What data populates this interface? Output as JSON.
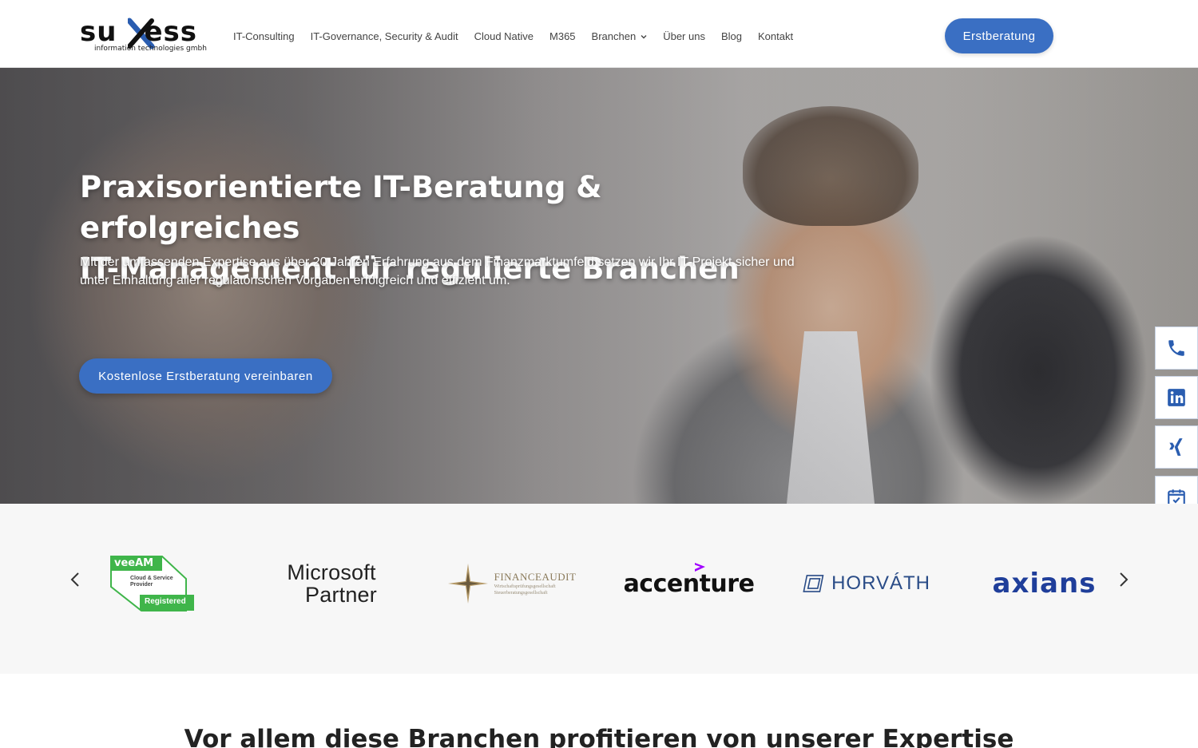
{
  "header": {
    "logo": {
      "name": "suxess",
      "sub": "information technologies gmbh"
    },
    "nav": [
      {
        "label": "IT-Consulting"
      },
      {
        "label": "IT-Governance, Security & Audit"
      },
      {
        "label": "Cloud Native"
      },
      {
        "label": "M365"
      },
      {
        "label": "Branchen",
        "has_dropdown": true
      },
      {
        "label": "Über uns"
      },
      {
        "label": "Blog"
      },
      {
        "label": "Kontakt"
      }
    ],
    "cta_label": "Erstberatung"
  },
  "hero": {
    "title_line1": "Praxisorientierte IT-Beratung & erfolgreiches",
    "title_line2": "IT-Management für regulierte Branchen",
    "subtitle": "Mit der umfassenden Expertise aus über 20 Jahren Erfahrung aus dem Finanzmarktumfeld setzen wir Ihr IT-Projekt sicher und unter Einhaltung aller regulatorischen Vorgaben erfolgreich und effizient um.",
    "cta_label": "Kostenlose Erstberatung vereinbaren"
  },
  "side_bar": {
    "items": [
      "phone-icon",
      "linkedin-icon",
      "xing-icon",
      "calendar-icon"
    ]
  },
  "partners": {
    "veeam": {
      "brand": "veeAM",
      "line1": "Cloud & Service",
      "line2": "Provider",
      "badge": "Registered"
    },
    "microsoft": {
      "line1": "Microsoft",
      "line2": "Partner"
    },
    "financeaudit": {
      "name": "FINANCEAUDIT",
      "sub1": "Wirtschaftsprüfungsgesellschaft",
      "sub2": "Steuerberatungsgesellschaft"
    },
    "accenture": {
      "name": "accenture"
    },
    "horvath": {
      "name": "HORVÁTH"
    },
    "axians": {
      "name": "axians"
    }
  },
  "section": {
    "heading": "Vor allem diese Branchen profitieren von unserer Expertise"
  },
  "colors": {
    "accent": "#3a6fc3",
    "brand_x": "#2a5db0",
    "veeam_green": "#3fb54a"
  }
}
